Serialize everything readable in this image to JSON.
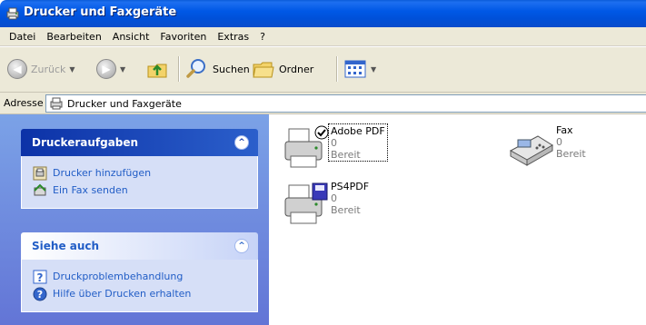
{
  "window": {
    "title": "Drucker und Faxgeräte"
  },
  "menu": [
    "Datei",
    "Bearbeiten",
    "Ansicht",
    "Favoriten",
    "Extras",
    "?"
  ],
  "toolbar": {
    "back_label": "Zurück",
    "search_label": "Suchen",
    "folders_label": "Ordner"
  },
  "address": {
    "label": "Adresse",
    "value": "Drucker und Faxgeräte"
  },
  "tasks_panel": {
    "title": "Druckeraufgaben",
    "items": [
      {
        "label": "Drucker hinzufügen",
        "icon": "add-printer-icon"
      },
      {
        "label": "Ein Fax senden",
        "icon": "send-fax-icon"
      }
    ]
  },
  "see_also_panel": {
    "title": "Siehe auch",
    "items": [
      {
        "label": "Druckproblembehandlung",
        "icon": "help-topic-icon"
      },
      {
        "label": "Hilfe über Drucken erhalten",
        "icon": "help-icon"
      }
    ]
  },
  "printers": [
    {
      "name": "Adobe PDF",
      "count": "0",
      "status": "Bereit",
      "default": true,
      "selected": true
    },
    {
      "name": "Fax",
      "count": "0",
      "status": "Bereit",
      "default": false,
      "selected": false
    },
    {
      "name": "PS4PDF",
      "count": "0",
      "status": "Bereit",
      "default": false,
      "selected": false
    }
  ],
  "colors": {
    "title_bar": "#0058e6",
    "task_pane": "#7ba2e7",
    "link": "#215dc6"
  }
}
